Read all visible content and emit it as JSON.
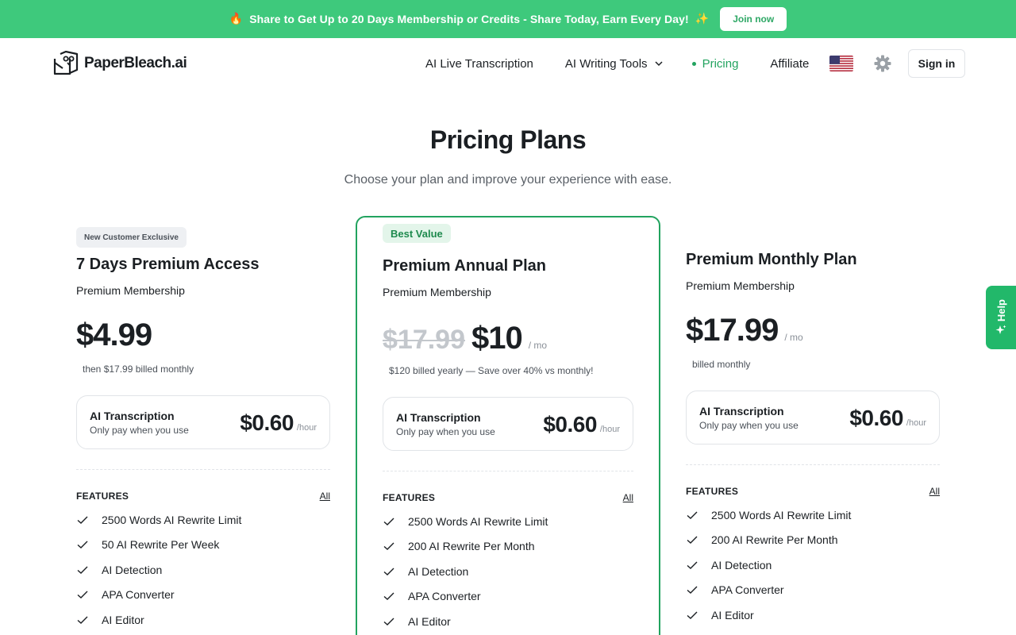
{
  "banner": {
    "emoji_left": "🔥",
    "text": "Share to Get Up to 20 Days Membership or Credits - Share Today, Earn Every Day!",
    "emoji_right": "✨",
    "button": "Join now"
  },
  "header": {
    "logo_text": "PaperBleach.ai",
    "nav": {
      "live": "AI Live Transcription",
      "writing": "AI Writing Tools",
      "pricing": "Pricing",
      "affiliate": "Affiliate"
    },
    "signin": "Sign in"
  },
  "hero": {
    "title": "Pricing Plans",
    "subtitle": "Choose your plan and improve your experience with ease."
  },
  "plans": [
    {
      "badge": "New Customer Exclusive",
      "name": "7 Days Premium Access",
      "sub": "Premium Membership",
      "price": "$4.99",
      "billing": "then $17.99 billed monthly",
      "ai": {
        "title": "AI Transcription",
        "desc": "Only pay when you use",
        "amount": "$0.60",
        "unit": "/hour"
      },
      "features_head": "FEATURES",
      "features_all": "All",
      "features": [
        "2500 Words AI Rewrite Limit",
        "50 AI Rewrite Per Week",
        "AI Detection",
        "APA Converter",
        "AI Editor"
      ]
    },
    {
      "badge": "Best Value",
      "name": "Premium Annual Plan",
      "sub": "Premium Membership",
      "price_old": "$17.99",
      "price": "$10",
      "per": "/ mo",
      "billing": "$120 billed yearly — Save over 40% vs monthly!",
      "ai": {
        "title": "AI Transcription",
        "desc": "Only pay when you use",
        "amount": "$0.60",
        "unit": "/hour"
      },
      "features_head": "FEATURES",
      "features_all": "All",
      "features": [
        "2500 Words AI Rewrite Limit",
        "200 AI Rewrite Per Month",
        "AI Detection",
        "APA Converter",
        "AI Editor"
      ]
    },
    {
      "name": "Premium Monthly Plan",
      "sub": "Premium Membership",
      "price": "$17.99",
      "per": "/ mo",
      "billing": "billed monthly",
      "ai": {
        "title": "AI Transcription",
        "desc": "Only pay when you use",
        "amount": "$0.60",
        "unit": "/hour"
      },
      "features_head": "FEATURES",
      "features_all": "All",
      "features": [
        "2500 Words AI Rewrite Limit",
        "200 AI Rewrite Per Month",
        "AI Detection",
        "APA Converter",
        "AI Editor"
      ]
    }
  ],
  "help": {
    "label": "Help"
  },
  "icons": {
    "logo": "owl-logo-icon",
    "chevron": "chevron-down-icon",
    "flag": "us-flag-icon",
    "settings": "gear-icon",
    "check": "check-icon",
    "help": "sparkle-icon"
  },
  "colors": {
    "brand": "#3ec97c",
    "accent": "#22a35f",
    "badge_bg": "#e3f5ea"
  }
}
